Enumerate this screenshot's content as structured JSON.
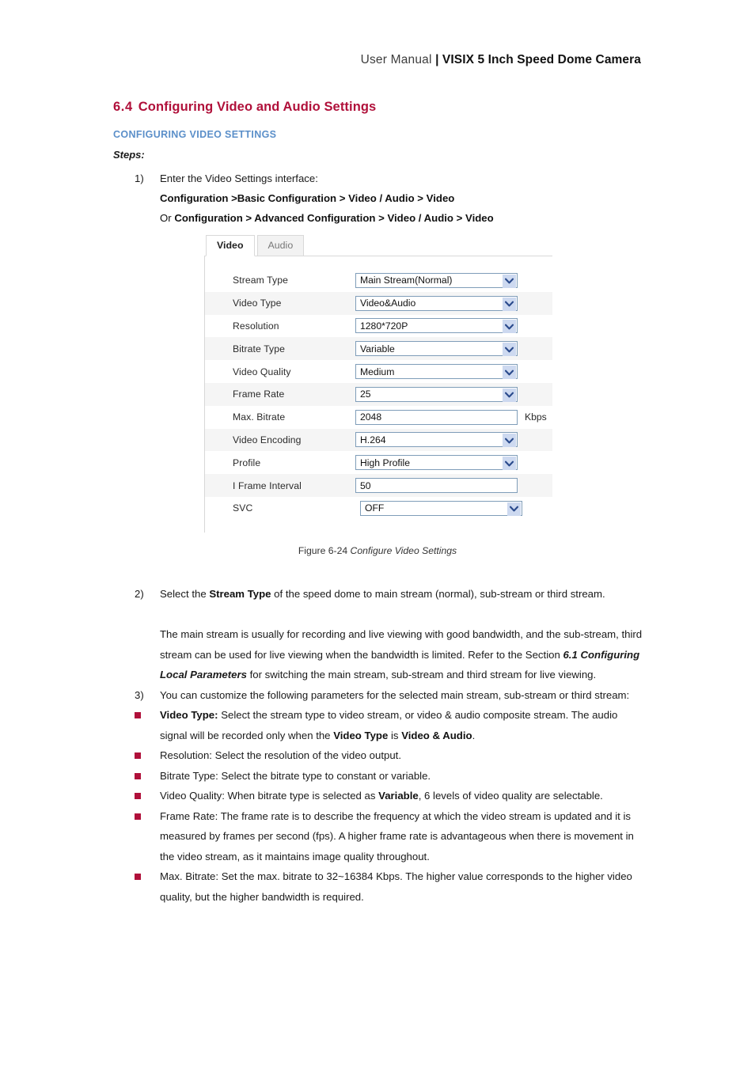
{
  "header": {
    "manual_label": "User Manual",
    "separator": " | ",
    "product": "VISIX 5 Inch Speed Dome Camera"
  },
  "section": {
    "number": "6.4",
    "title": "Configuring Video and Audio Settings",
    "subheading": "CONFIGURING VIDEO SETTINGS",
    "steps_label": "Steps:"
  },
  "step1": {
    "marker": "1)",
    "text": "Enter the Video Settings interface:",
    "path_primary_prefix": "",
    "path_primary": "Configuration >Basic Configuration > Video / Audio > Video",
    "path_or_prefix": "Or ",
    "path_secondary": "Configuration > Advanced Configuration > Video / Audio > Video"
  },
  "figure": {
    "caption_prefix": "Figure 6-24 ",
    "caption_title": "Configure Video Settings",
    "tabs": [
      {
        "label": "Video",
        "active": true
      },
      {
        "label": "Audio",
        "active": false
      }
    ],
    "rows": [
      {
        "label": "Stream Type",
        "value": "Main Stream(Normal)",
        "control": "select",
        "striped": false,
        "unit": ""
      },
      {
        "label": "Video Type",
        "value": "Video&Audio",
        "control": "select",
        "striped": true,
        "unit": ""
      },
      {
        "label": "Resolution",
        "value": "1280*720P",
        "control": "select",
        "striped": false,
        "unit": ""
      },
      {
        "label": "Bitrate Type",
        "value": "Variable",
        "control": "select",
        "striped": true,
        "unit": ""
      },
      {
        "label": "Video Quality",
        "value": "Medium",
        "control": "select",
        "striped": false,
        "unit": ""
      },
      {
        "label": "Frame Rate",
        "value": "25",
        "control": "select",
        "striped": true,
        "unit": ""
      },
      {
        "label": "Max. Bitrate",
        "value": "2048",
        "control": "text",
        "striped": false,
        "unit": "Kbps"
      },
      {
        "label": "Video Encoding",
        "value": "H.264",
        "control": "select",
        "striped": true,
        "unit": ""
      },
      {
        "label": "Profile",
        "value": "High Profile",
        "control": "select",
        "striped": false,
        "unit": ""
      },
      {
        "label": "I Frame Interval",
        "value": "50",
        "control": "text",
        "striped": true,
        "unit": ""
      },
      {
        "label": "SVC",
        "value": "OFF",
        "control": "select",
        "striped": false,
        "unit": ""
      }
    ]
  },
  "step2": {
    "marker": "2)",
    "text_a": "Select the ",
    "bold_a": "Stream Type",
    "text_b": " of the speed dome to main stream (normal), sub-stream or third stream.",
    "para_a": "The main stream is usually for recording and live viewing with good bandwidth, and the sub-stream, third stream can be used for live viewing when the bandwidth is limited. Refer to the Section ",
    "para_bolditalic": "6.1 Configuring Local Parameters",
    "para_b": " for switching the main stream, sub-stream and third stream for live viewing."
  },
  "step3": {
    "marker": "3)",
    "text": "You can customize the following parameters for the selected main stream, sub-stream or third stream:"
  },
  "bullets": [
    {
      "term": "Video Type",
      "term_bold": true,
      "sep": ":",
      "text_a": "   Select the stream type to video stream, or video & audio composite stream. The audio signal will be recorded only when the ",
      "bold_a": "Video Type",
      "text_b": " is ",
      "bold_b": "Video & Audio",
      "text_c": "."
    },
    {
      "term": "Resolution:",
      "term_bold": false,
      "sep": "",
      "text_a": "   Select the resolution of the video output.",
      "bold_a": "",
      "text_b": "",
      "bold_b": "",
      "text_c": ""
    },
    {
      "term": "Bitrate Type:",
      "term_bold": false,
      "sep": "",
      "text_a": "   Select the bitrate type to constant or variable.",
      "bold_a": "",
      "text_b": "",
      "bold_b": "",
      "text_c": ""
    },
    {
      "term": "Video Quality:",
      "term_bold": false,
      "sep": "",
      "text_a": "   When bitrate type is selected as ",
      "bold_a": "Variable",
      "text_b": ", 6 levels of video quality are selectable.",
      "bold_b": "",
      "text_c": ""
    },
    {
      "term": "Frame Rate:",
      "term_bold": false,
      "sep": "",
      "text_a": "   The frame rate is to describe the frequency at which the video stream is updated and it is measured by frames per second (fps). A higher frame rate is advantageous when there is movement in the video stream, as it maintains image quality throughout.",
      "bold_a": "",
      "text_b": "",
      "bold_b": "",
      "text_c": ""
    },
    {
      "term": "Max. Bitrate:",
      "term_bold": false,
      "sep": "",
      "text_a": "   Set the max. bitrate to 32~16384 Kbps. The higher value corresponds to the higher video quality, but the higher bandwidth is required.",
      "bold_a": "",
      "text_b": "",
      "bold_b": "",
      "text_c": ""
    }
  ],
  "colors": {
    "heading_red": "#b0103a",
    "subheading_blue": "#5b8fc9",
    "bullet_red": "#b0103a",
    "field_border": "#7f9db9",
    "chevron_bg": "#cdd9f0",
    "stripe": "#f5f5f5"
  }
}
